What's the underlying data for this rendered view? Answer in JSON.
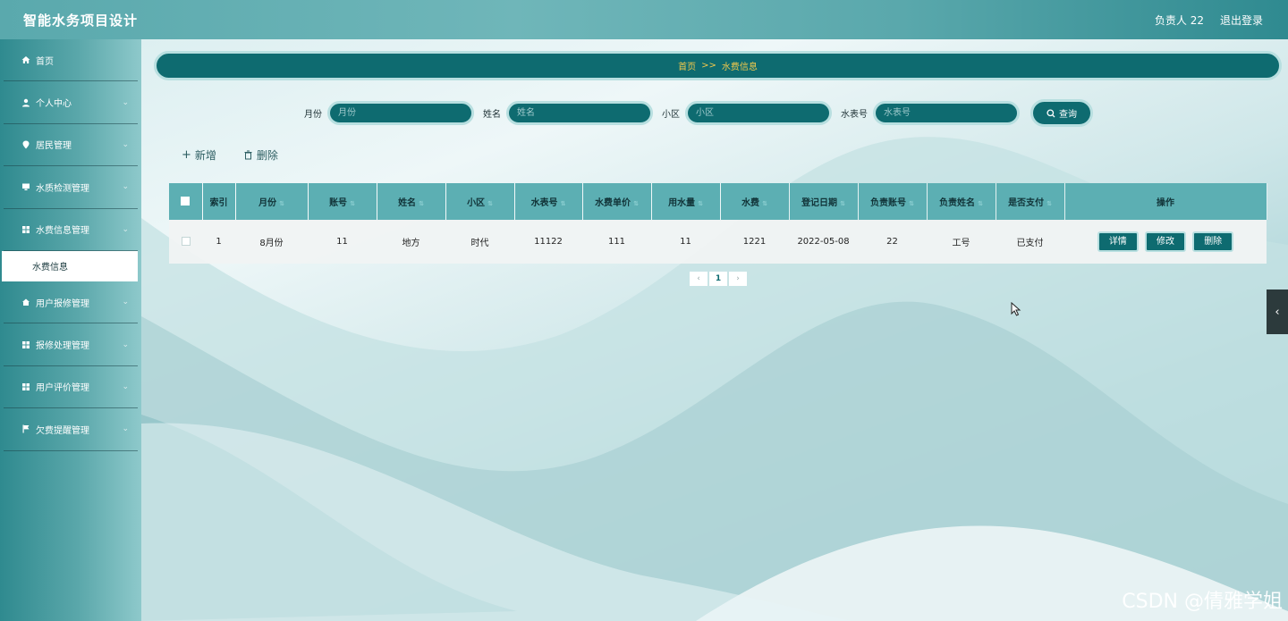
{
  "header": {
    "title": "智能水务项目设计",
    "user": "负责人 22",
    "logout": "退出登录"
  },
  "sidebar": {
    "items": [
      {
        "label": "首页",
        "icon": "home-icon",
        "expandable": false
      },
      {
        "label": "个人中心",
        "icon": "user-icon",
        "expandable": true
      },
      {
        "label": "居民管理",
        "icon": "location-pin-icon",
        "expandable": true
      },
      {
        "label": "水质检测管理",
        "icon": "monitor-icon",
        "expandable": true
      },
      {
        "label": "水费信息管理",
        "icon": "grid-icon",
        "expandable": true
      },
      {
        "label": "用户报修管理",
        "icon": "home-repair-icon",
        "expandable": true
      },
      {
        "label": "报修处理管理",
        "icon": "grid-icon",
        "expandable": true
      },
      {
        "label": "用户评价管理",
        "icon": "grid-icon",
        "expandable": true
      },
      {
        "label": "欠费提醒管理",
        "icon": "flag-icon",
        "expandable": true
      }
    ],
    "submenu": {
      "label": "水费信息"
    }
  },
  "breadcrumb": {
    "home": "首页",
    "separator": ">>",
    "current": "水费信息"
  },
  "search": {
    "month_label": "月份",
    "month_placeholder": "月份",
    "name_label": "姓名",
    "name_placeholder": "姓名",
    "district_label": "小区",
    "district_placeholder": "小区",
    "meter_label": "水表号",
    "meter_placeholder": "水表号",
    "button": "查询"
  },
  "actions": {
    "add": "新增",
    "delete": "删除"
  },
  "table": {
    "headers": [
      "索引",
      "月份",
      "账号",
      "姓名",
      "小区",
      "水表号",
      "水费单价",
      "用水量",
      "水费",
      "登记日期",
      "负责账号",
      "负责姓名",
      "是否支付",
      "操作"
    ],
    "rows": [
      {
        "index": "1",
        "month": "8月份",
        "account": "11",
        "name": "地方",
        "district": "时代",
        "meter": "11122",
        "unit_price": "111",
        "usage": "11",
        "fee": "1221",
        "date": "2022-05-08",
        "mgr_account": "22",
        "mgr_name": "工号",
        "paid": "已支付"
      }
    ],
    "row_buttons": {
      "detail": "详情",
      "edit": "修改",
      "delete": "删除"
    }
  },
  "pagination": {
    "current": "1",
    "prev": "‹",
    "next": "›"
  },
  "side_tab": {
    "icon": "chevron-left-icon",
    "glyph": "‹"
  },
  "watermark": "CSDN @倩雅学姐",
  "colors": {
    "accent": "#0e6b70",
    "header": "#5cafb3",
    "breadcrumb_text": "#f2c94c"
  }
}
